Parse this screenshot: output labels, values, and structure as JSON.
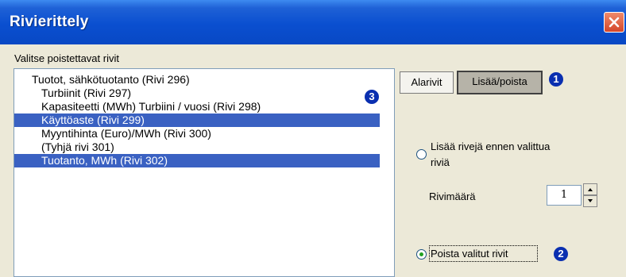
{
  "window": {
    "title": "Rivierittely"
  },
  "section_label": "Valitse poistettavat rivit",
  "list": {
    "items": [
      {
        "label": "Tuotot, sähkötuotanto (Rivi 296)",
        "selected": false
      },
      {
        "label": "Turbiinit (Rivi 297)",
        "selected": false
      },
      {
        "label": "Kapasiteetti (MWh) Turbiini / vuosi (Rivi 298)",
        "selected": false
      },
      {
        "label": "Käyttöaste (Rivi 299)",
        "selected": true
      },
      {
        "label": "Myyntihinta (Euro)/MWh (Rivi 300)",
        "selected": false
      },
      {
        "label": "(Tyhjä rivi 301)",
        "selected": false
      },
      {
        "label": "Tuotanto, MWh (Rivi 302)",
        "selected": true
      }
    ]
  },
  "tabs": {
    "alarivit": "Alarivit",
    "lisaa_poista": "Lisää/poista"
  },
  "options": {
    "insert_label_line1": "Lisää rivejä ennen valittua",
    "insert_label_line2": "riviä",
    "row_count_label": "Rivimäärä",
    "row_count_value": "1",
    "delete_label": "Poista valitut rivit",
    "selected_option": "delete"
  },
  "badges": {
    "one": "1",
    "two": "2",
    "three": "3"
  },
  "colors": {
    "titlebar": "#0a4fd0",
    "selection": "#3a61c2",
    "badge": "#0a2fb0",
    "dialog": "#ece9d8"
  }
}
